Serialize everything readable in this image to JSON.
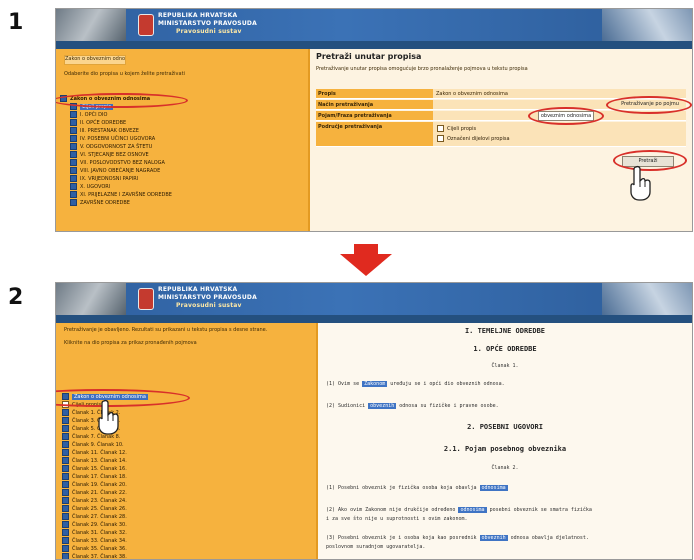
{
  "steps": [
    "1",
    "2"
  ],
  "header": {
    "title_line1": "REPUBLIKA HRVATSKA",
    "title_line2": "MINISTARSTVO PRAVOSUDA",
    "title_line3": "Pravosudni sustav"
  },
  "screen1": {
    "panel_title": "Pretraži unutar propisa",
    "intro_text": "Pretraživanje unutar propisa omogućuje brzo pronalaženje pojmova u tekstu propisa",
    "left_header": "Zakon o obveznim odnosima",
    "left_intro": "Odaberite dio propisa u kojem želite pretraživati",
    "root_item": "Zakon o obveznim odnosima",
    "selected_item": "Cijeli propis",
    "tree": [
      "I. OPĆI DIO",
      "II. OPĆE ODREDBE",
      "III. PRESTANAK OBVEZE",
      "IV. POSEBNI UČINCI UGOVORA",
      "V. ODGOVORNOST ZA ŠTETU",
      "VI. STJECANJE BEZ OSNOVE",
      "VII. POSLOVODSTVO BEZ NALOGA",
      "VIII. JAVNO OBEĆANJE NAGRADE",
      "IX. VRIJEDNOSNI PAPIRI",
      "X. UGOVORI",
      "XI. PRIJELAZNE I ZAVRŠNE ODREDBE",
      "ZAVRŠNE ODREDBE"
    ],
    "form": {
      "rows": [
        {
          "label": "Propis",
          "value": "Zakon o obveznim odnosima"
        },
        {
          "label": "Način pretraživanja",
          "value": ""
        },
        {
          "label": "Pojam/Fraza pretraživanja",
          "value": ""
        },
        {
          "label": "Područje pretraživanja",
          "value": ""
        }
      ],
      "search_type_value": "Pretraživanje po pojmu",
      "phrase_value": "obveznim odnosima",
      "option1": "Cijeli propis",
      "option2": "Označeni dijelovi propisa",
      "search_button": "Pretraži"
    }
  },
  "screen2": {
    "left_intro": "Pretraživanje je obavljeno. Rezultati su prikazani u tekstu propisa s desne strane.",
    "left_intro2": "Kliknite na dio propisa za prikaz pronađenih pojmova",
    "selected_item": "Zakon o obveznim odnosima",
    "sub_item": "Cijeli propis",
    "tree": [
      "Članak 1. Članak 2.",
      "Članak 3. Članak 4.",
      "Članak 5. Članak 6.",
      "Članak 7. Članak 8.",
      "Članak 9. Članak 10.",
      "Članak 11. Članak 12.",
      "Članak 13. Članak 14.",
      "Članak 15. Članak 16.",
      "Članak 17. Članak 18.",
      "Članak 19. Članak 20.",
      "Članak 21. Članak 22.",
      "Članak 23. Članak 24.",
      "Članak 25. Članak 26.",
      "Članak 27. Članak 28.",
      "Članak 29. Članak 30.",
      "Članak 31. Članak 32.",
      "Članak 33. Članak 34.",
      "Članak 35. Članak 36.",
      "Članak 37. Članak 38.",
      "Članak 39. Članak 40.",
      "Članak 41. Članak 42."
    ],
    "doc": {
      "h1": "I. TEMELJNE ODREDBE",
      "h2": "1. OPĆE ODREDBE",
      "c1": "Članak 1.",
      "p1a": "(1) Ovim se",
      "p1hl": "Zakonom",
      "p1b": "uređuju se i opći dio obveznih odnosa.",
      "p2a": "(2) Sudionici",
      "p2hl": "obveznih",
      "p2b": "odnosa su fizičke i pravne osobe.",
      "h3": "2. POSEBNI UGOVORI",
      "h4": "2.1. Pojam posebnog obveznika",
      "c2": "Članak 2.",
      "p3a": "(1) Posebni obveznik je fizička osoba koja obavlja",
      "p3hl": "odnosima",
      "p4a": "(2) Ako ovim Zakonom nije drukčije određeno",
      "p4hl": "odnosima",
      "p4b": "posebni obveznik se smatra fizička",
      "p5": "i za sve što nije u suprotnosti s ovim zakonom.",
      "p6a": "(3) Posebni obveznik je i osoba koja kao posrednik",
      "p6hl": "obveznih",
      "p6b": "odnosa obavlja djelatnost.",
      "p7": "poslovnom suradnjom ugovaratelja."
    }
  }
}
